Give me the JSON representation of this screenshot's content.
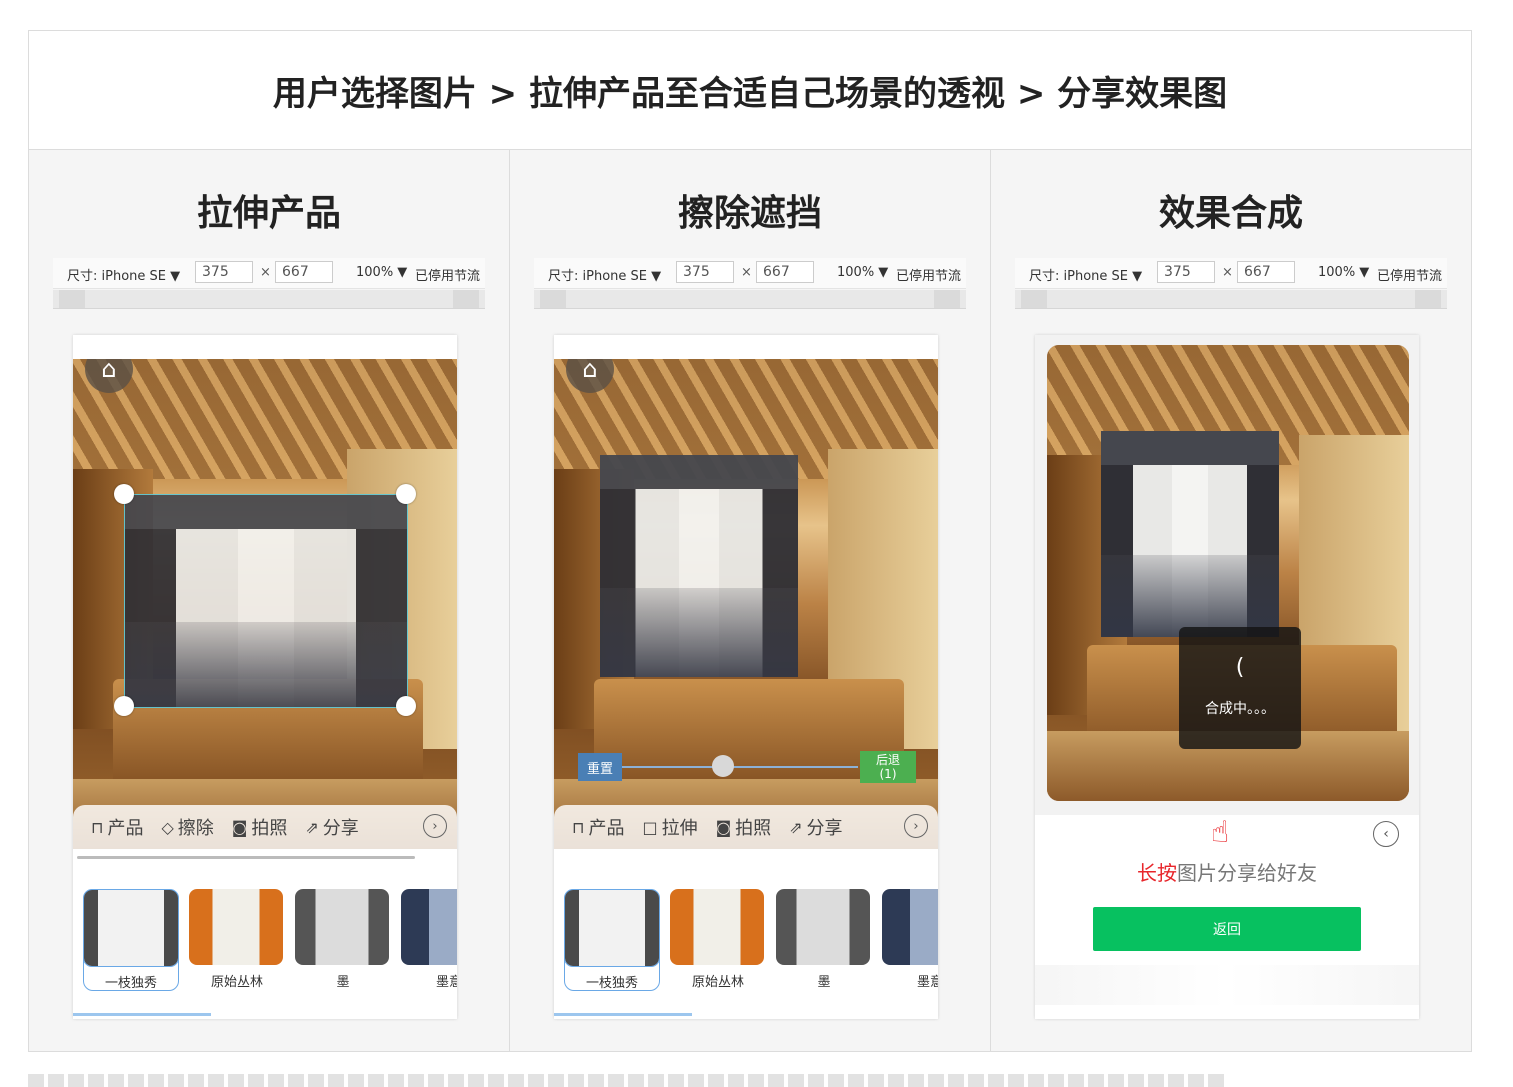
{
  "main_title": "用户选择图片 > 拉伸产品至合适自己场景的透视 > 分享效果图",
  "columns": [
    {
      "title": "拉伸产品"
    },
    {
      "title": "擦除遮挡"
    },
    {
      "title": "效果合成"
    }
  ],
  "devtools": {
    "size_label": "尺寸: iPhone SE ▼",
    "width": "375",
    "x": "×",
    "height": "667",
    "zoom": "100% ▼",
    "throttle": "已停用节流"
  },
  "toolbar1": [
    {
      "icon": "product-icon",
      "label": "产品"
    },
    {
      "icon": "eraser-icon",
      "label": "擦除"
    },
    {
      "icon": "camera-icon",
      "label": "拍照"
    },
    {
      "icon": "share-icon",
      "label": "分享"
    }
  ],
  "toolbar2": [
    {
      "icon": "product-icon",
      "label": "产品"
    },
    {
      "icon": "stretch-icon",
      "label": "拉伸"
    },
    {
      "icon": "camera-icon",
      "label": "拍照"
    },
    {
      "icon": "share-icon",
      "label": "分享"
    }
  ],
  "products": [
    "一枝独秀",
    "原始丛林",
    "墨",
    "墨意"
  ],
  "erase_controls": {
    "reset": "重置",
    "back": "后退",
    "back_count": "(1)"
  },
  "result": {
    "loading_text": "合成中。。。",
    "longpress_highlight": "长按",
    "longpress_rest": "图片分享给好友",
    "return_label": "返回"
  },
  "colors": {
    "accent_green": "#07c160",
    "highlight_red": "#e8262b",
    "selected_border": "#6aa8e6"
  }
}
